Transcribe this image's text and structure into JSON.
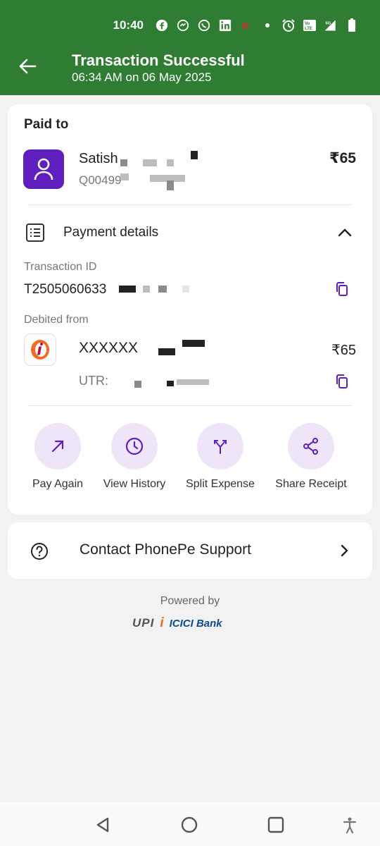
{
  "status_bar": {
    "time": "10:40",
    "icons": [
      "facebook-icon",
      "messenger-icon",
      "whatsapp-icon",
      "linkedin-icon",
      "app-r-icon",
      "dot-icon",
      "alarm-icon",
      "volte-icon",
      "signal-5g-icon",
      "battery-icon"
    ]
  },
  "header": {
    "title": "Transaction Successful",
    "subtitle": "06:34 AM on 06 May 2025",
    "bg_color": "#2e7d32"
  },
  "paid_to": {
    "heading": "Paid to",
    "name": "Satish",
    "id": "Q00499",
    "amount": "₹65"
  },
  "payment_details": {
    "label": "Payment details",
    "transaction_id_label": "Transaction ID",
    "transaction_id": "T2505060633",
    "debited_from_label": "Debited from",
    "account": "XXXXXX",
    "debit_amount": "₹65",
    "utr_label": "UTR:"
  },
  "actions": [
    {
      "label": "Pay Again",
      "icon": "arrow-up-right-icon"
    },
    {
      "label": "View History",
      "icon": "clock-icon"
    },
    {
      "label": "Split Expense",
      "icon": "split-icon"
    },
    {
      "label": "Share Receipt",
      "icon": "share-icon"
    }
  ],
  "support": {
    "label": "Contact PhonePe Support"
  },
  "footer": {
    "powered_by": "Powered by",
    "upi_label": "UPI",
    "bank_label": "ICICI Bank"
  },
  "colors": {
    "accent": "#5f1fbf",
    "action_bg": "#efe5f8",
    "page_bg": "#f2f2f3"
  }
}
